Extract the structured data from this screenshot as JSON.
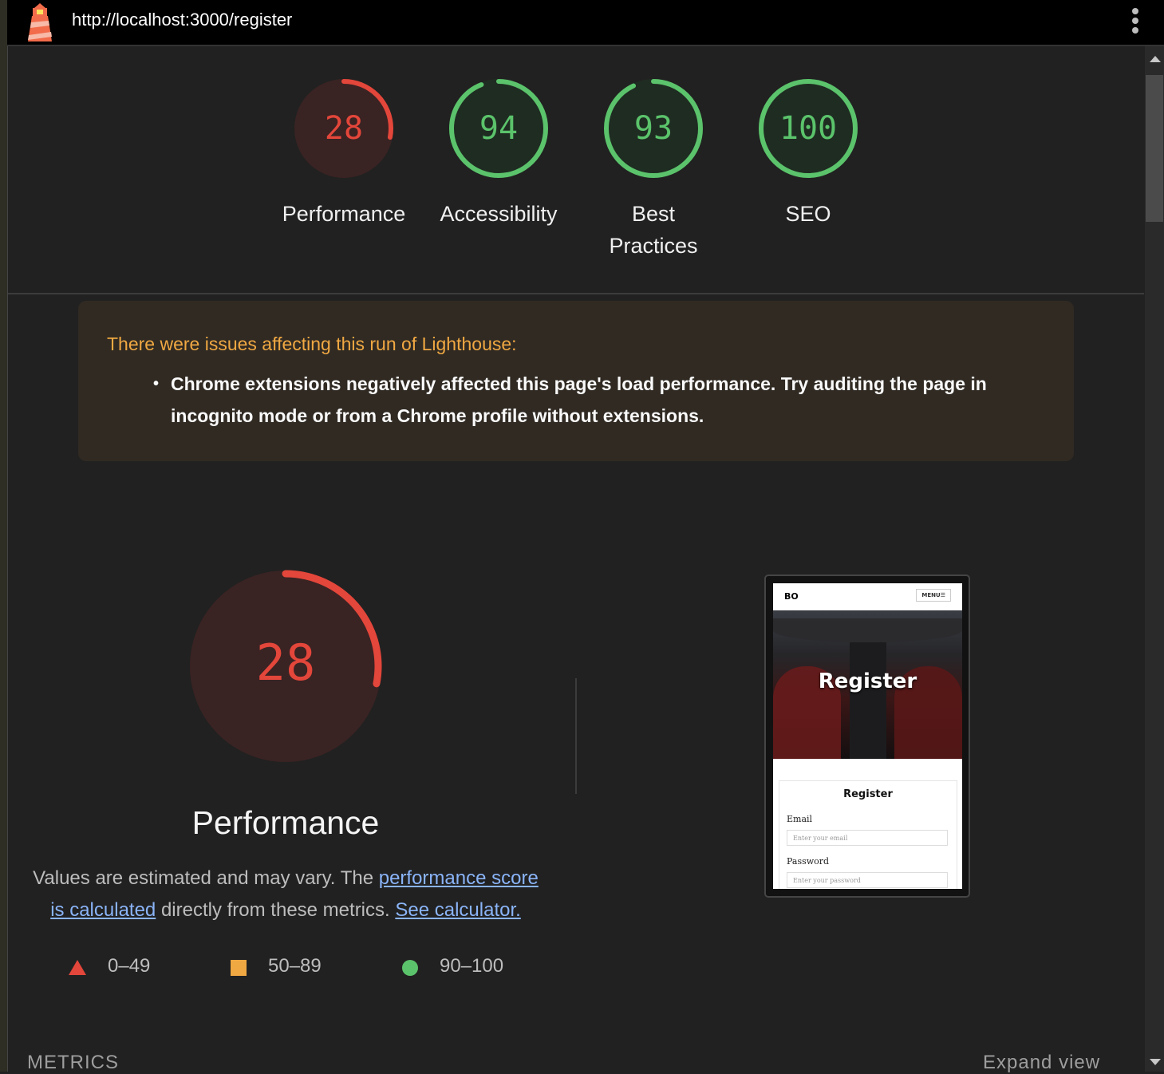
{
  "browser": {
    "url": "http://localhost:3000/register"
  },
  "categories": [
    {
      "label": "Performance",
      "score": 28,
      "color": "#e3463a"
    },
    {
      "label": "Accessibility",
      "score": 94,
      "color": "#5bc36b"
    },
    {
      "label": "Best Practices",
      "score": 93,
      "color": "#5bc36b"
    },
    {
      "label": "SEO",
      "score": 100,
      "color": "#5bc36b"
    }
  ],
  "warning": {
    "title": "There were issues affecting this run of Lighthouse:",
    "items": [
      "Chrome extensions negatively affected this page's load performance. Try auditing the page in incognito mode or from a Chrome profile without extensions."
    ]
  },
  "performance": {
    "score": "28",
    "title": "Performance",
    "desc_part1": "Values are estimated and may vary. The ",
    "link_score": "performance score is calculated",
    "desc_part2": " directly from these metrics. ",
    "link_calc": "See calculator."
  },
  "legend": {
    "fail": "0–49",
    "average": "50–89",
    "pass": "90–100"
  },
  "screenshot": {
    "logo": "BO",
    "menu": "MENU☰",
    "hero_title": "Register",
    "card_title": "Register",
    "email_label": "Email",
    "email_placeholder": "Enter your email",
    "password_label": "Password",
    "password_placeholder": "Enter your password"
  },
  "footer": {
    "metrics": "METRICS",
    "expand": "Expand view"
  },
  "colors": {
    "fail": "#e3463a",
    "average": "#f0a842",
    "pass": "#5bc36b",
    "link": "#8ab4f8"
  }
}
